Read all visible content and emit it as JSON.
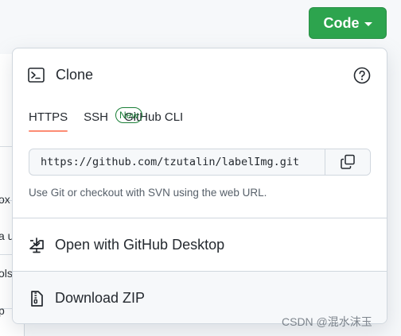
{
  "code_button": {
    "label": "Code"
  },
  "background": {
    "fragments": [
      "ox",
      "a u",
      "ols",
      "p"
    ]
  },
  "clone": {
    "title": "Clone",
    "tabs": [
      {
        "label": "HTTPS",
        "active": true
      },
      {
        "label": "SSH",
        "active": false
      },
      {
        "label": "GitHub CLI",
        "active": false,
        "badge": "New"
      }
    ],
    "url": "https://github.com/tzutalin/labelImg.git",
    "hint": "Use Git or checkout with SVN using the web URL."
  },
  "actions": {
    "open_desktop": "Open with GitHub Desktop",
    "download_zip": "Download ZIP"
  },
  "watermark": "CSDN @混水沫玉",
  "icons": {
    "terminal": "terminal-icon",
    "help": "question-icon",
    "copy": "copy-icon",
    "desktop": "desktop-download-icon",
    "zip": "file-zip-icon"
  },
  "colors": {
    "primary_button": "#2da44e",
    "active_tab_underline": "#fd8c73",
    "badge": "#1a7f37"
  }
}
